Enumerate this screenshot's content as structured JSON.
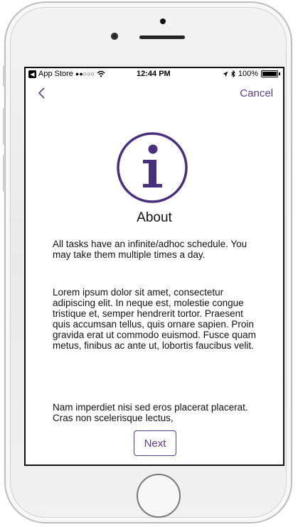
{
  "status_bar": {
    "carrier": "App Store",
    "signal": "●●○○○",
    "time": "12:44 PM",
    "battery": "100%"
  },
  "nav": {
    "cancel_label": "Cancel"
  },
  "content": {
    "title": "About",
    "paragraph1": "All tasks have an infinite/adhoc schedule. You may take them multiple times a day.",
    "paragraph2": "Lorem ipsum dolor sit amet, consectetur adipiscing elit. In neque est, molestie congue tristique et, semper hendrerit tortor. Praesent quis accumsan tellus, quis ornare sapien. Proin gravida erat ut commodo euismod. Fusce quam metus, finibus ac ante ut, lobortis faucibus velit.",
    "paragraph3": "Nam imperdiet nisi sed eros placerat placerat. Cras non scelerisque lectus,",
    "next_label": "Next"
  },
  "colors": {
    "accent": "#5a3d8c"
  },
  "icons": [
    "back-chevron-icon",
    "info-icon",
    "wifi-icon",
    "location-arrow-icon",
    "bluetooth-icon",
    "battery-icon"
  ]
}
